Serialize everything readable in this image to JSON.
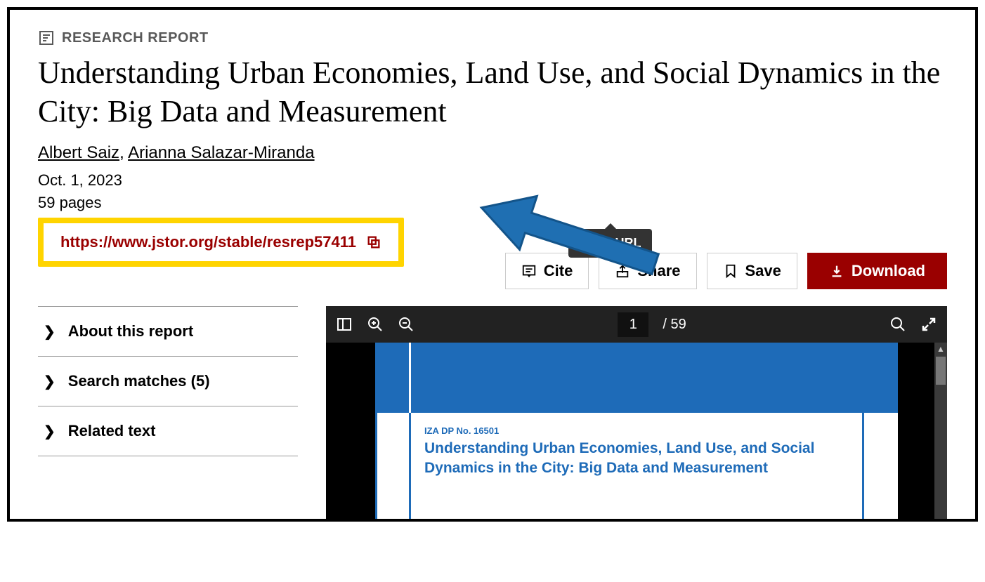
{
  "doc_type": "RESEARCH REPORT",
  "title": "Understanding Urban Economies, Land Use, and Social Dynamics in the City: Big Data and Measurement",
  "authors": [
    "Albert Saiz",
    "Arianna Salazar-Miranda"
  ],
  "date": "Oct. 1, 2023",
  "pages_line": "59 pages",
  "stable_url": "https://www.jstor.org/stable/resrep57411",
  "tooltip": "Copy URL",
  "actions": {
    "cite": "Cite",
    "share": "Share",
    "save": "Save",
    "download": "Download"
  },
  "sidebar": {
    "about": "About this report",
    "matches": "Search matches (5)",
    "related": "Related text"
  },
  "viewer": {
    "current_page": "1",
    "page_sep": "/ 59",
    "iza_line": "IZA DP No. 16501",
    "paper_title": "Understanding Urban Economies, Land Use, and Social Dynamics in the City: Big Data and Measurement"
  }
}
